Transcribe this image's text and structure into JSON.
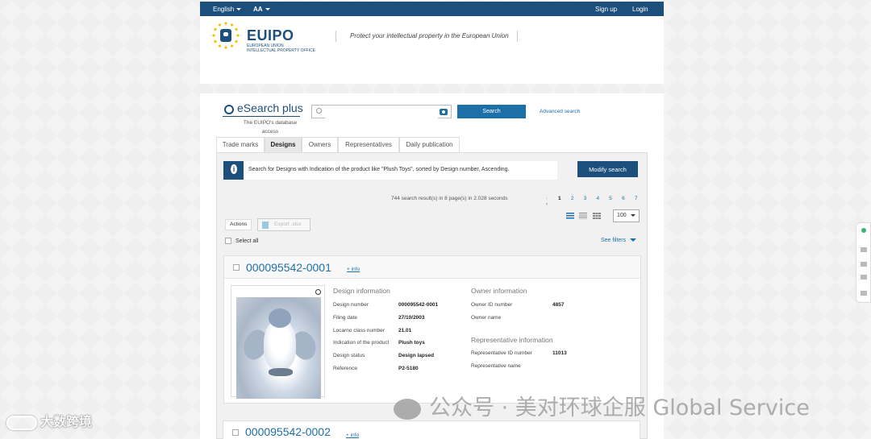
{
  "topbar": {
    "language": "English",
    "text_size": "AA",
    "signup": "Sign up",
    "login": "Login"
  },
  "header": {
    "logo_text": "EUIPO",
    "logo_sub_1": "EUROPEAN UNION",
    "logo_sub_2": "INTELLECTUAL PROPERTY OFFICE",
    "tagline": "Protect your intellectual property in the European Union"
  },
  "esearch": {
    "title": "eSearch plus",
    "subtitle": "The EUIPO's database access",
    "search_value": "",
    "search_button": "Search",
    "advanced": "Advanced search"
  },
  "tabs": [
    "Trade marks",
    "Designs",
    "Owners",
    "Representatives",
    "Daily publication"
  ],
  "info_bar": {
    "text": "Search for Designs with Indication of the product like \"Plush Toys\", sorted by Design number, Ascending."
  },
  "modify_search": "Modify search",
  "results": {
    "summary": "744 search result(s) in 8 page(s) in 2.028 seconds",
    "pages": [
      "1",
      "2",
      "3",
      "4",
      "5",
      "6",
      "7"
    ],
    "current_page": "1",
    "per_page": "100"
  },
  "actions_label": "Actions",
  "export_label": "Export .xlsx",
  "select_all": "Select all",
  "see_filters": "See filters",
  "result1": {
    "number": "000095542-0001",
    "more_info": "+ info",
    "design_info_title": "Design information",
    "design_fields": [
      {
        "label": "Design number",
        "value": "000095542-0001"
      },
      {
        "label": "Filing date",
        "value": "27/10/2003"
      },
      {
        "label": "Locarno class number",
        "value": "21.01"
      },
      {
        "label": "Indication of the product",
        "value": "Plush toys"
      },
      {
        "label": "Design status",
        "value": "Design lapsed"
      },
      {
        "label": "Reference",
        "value": "P2-5180"
      }
    ],
    "owner_info_title": "Owner information",
    "owner_fields": [
      {
        "label": "Owner ID number",
        "value": "4857"
      },
      {
        "label": "Owner name",
        "value": ""
      }
    ],
    "rep_info_title": "Representative information",
    "rep_fields": [
      {
        "label": "Representative ID number",
        "value": "11013"
      },
      {
        "label": "Representative name",
        "value": ""
      }
    ]
  },
  "result2": {
    "number": "000095542-0002",
    "more_info": "+ info"
  },
  "watermark_left": "大数跨境",
  "watermark_right": "公众号 · 美对环球企服 Global Service",
  "colors": {
    "brand_dark": "#1d4f7c",
    "brand_blue": "#1d6fa8"
  }
}
